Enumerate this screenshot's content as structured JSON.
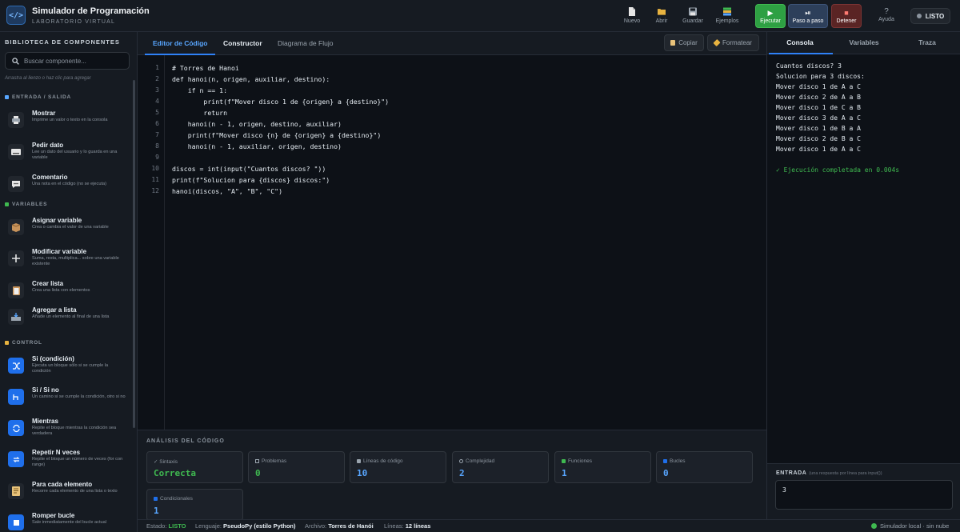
{
  "app": {
    "logo": "</>",
    "title": "Simulador de Programación",
    "subtitle": "LABORATORIO VIRTUAL"
  },
  "toolbar": {
    "nuevo": "Nuevo",
    "abrir": "Abrir",
    "guardar": "Guardar",
    "ejemplos": "Ejemplos",
    "ejecutar": "Ejecutar",
    "paso": "Paso a paso",
    "detener": "Detener",
    "ayuda": "Ayuda",
    "status": "LISTO"
  },
  "sidebar": {
    "title": "BIBLIOTECA DE COMPONENTES",
    "search_placeholder": "Buscar componente...",
    "hint": "Arrastra al lienzo o haz clic para agregar",
    "sections": {
      "io": "ENTRADA / SALIDA",
      "vars": "VARIABLES",
      "control": "CONTROL"
    },
    "items": [
      {
        "name": "Mostrar",
        "desc": "Imprime un valor o texto en la consola"
      },
      {
        "name": "Pedir dato",
        "desc": "Lee un dato del usuario y lo guarda en una variable"
      },
      {
        "name": "Comentario",
        "desc": "Una nota en el código (no se ejecuta)"
      },
      {
        "name": "Asignar variable",
        "desc": "Crea o cambia el valor de una variable"
      },
      {
        "name": "Modificar variable",
        "desc": "Suma, resta, multiplica... sobre una variable existente"
      },
      {
        "name": "Crear lista",
        "desc": "Crea una lista con elementos"
      },
      {
        "name": "Agregar a lista",
        "desc": "Añade un elemento al final de una lista"
      },
      {
        "name": "Si (condición)",
        "desc": "Ejecuta un bloque sólo si se cumple la condición"
      },
      {
        "name": "Si / Si no",
        "desc": "Un camino si se cumple la condición, otro si no"
      },
      {
        "name": "Mientras",
        "desc": "Repite el bloque mientras la condición sea verdadera"
      },
      {
        "name": "Repetir N veces",
        "desc": "Repite el bloque un número de veces (for con range)"
      },
      {
        "name": "Para cada elemento",
        "desc": "Recorre cada elemento de una lista o texto"
      },
      {
        "name": "Romper bucle",
        "desc": "Sale inmediatamente del bucle actual"
      }
    ]
  },
  "editor": {
    "tabs": [
      "Editor de Código",
      "Constructor",
      "Diagrama de Flujo"
    ],
    "copy": "Copiar",
    "format": "Formatear",
    "lines": [
      "# Torres de Hanoi",
      "def hanoi(n, origen, auxiliar, destino):",
      "    if n == 1:",
      "        print(f\"Mover disco 1 de {origen} a {destino}\")",
      "        return",
      "    hanoi(n - 1, origen, destino, auxiliar)",
      "    print(f\"Mover disco {n} de {origen} a {destino}\")",
      "    hanoi(n - 1, auxiliar, origen, destino)",
      "",
      "discos = int(input(\"Cuantos discos? \"))",
      "print(f\"Solucion para {discos} discos:\")",
      "hanoi(discos, \"A\", \"B\", \"C\")"
    ],
    "line_numbers": [
      "1",
      "2",
      "3",
      "4",
      "5",
      "6",
      "7",
      "8",
      "9",
      "10",
      "11",
      "12"
    ]
  },
  "analysis": {
    "title": "ANÁLISIS DEL CÓDIGO",
    "cards": [
      {
        "label": "✓ Sintaxis",
        "value": "Correcta"
      },
      {
        "label": "Problemas",
        "value": "0"
      },
      {
        "label": "Líneas de código",
        "value": "10"
      },
      {
        "label": "Complejidad",
        "value": "2"
      },
      {
        "label": "Funciones",
        "value": "1"
      },
      {
        "label": "Bucles",
        "value": "0"
      },
      {
        "label": "Condicionales",
        "value": "1"
      }
    ]
  },
  "statusbar": {
    "estado_label": "Estado:",
    "estado": "LISTO",
    "lenguaje_label": "Lenguaje:",
    "lenguaje": "PseudoPy (estilo Python)",
    "archivo_label": "Archivo:",
    "archivo": "Torres de Hanói",
    "lineas_label": "Líneas:",
    "lineas": "12 líneas",
    "local": "Simulador local · sin nube"
  },
  "right": {
    "tabs": [
      "Consola",
      "Variables",
      "Traza"
    ],
    "console": [
      "Cuantos discos? 3",
      "Solucion para 3 discos:",
      "Mover disco 1 de A a C",
      "Mover disco 2 de A a B",
      "Mover disco 1 de C a B",
      "Mover disco 3 de A a C",
      "Mover disco 1 de B a A",
      "Mover disco 2 de B a C",
      "Mover disco 1 de A a C"
    ],
    "done": "✓ Ejecución completada en 0.004s",
    "input_label": "ENTRADA",
    "input_hint": "(una respuesta por línea para input())",
    "input_value": "3"
  },
  "colors": {
    "accent": "#2f81f7",
    "run": "#2ea043",
    "step": "#2d3f5a",
    "stop": "#6e2b2b",
    "ok": "#3fb950"
  }
}
